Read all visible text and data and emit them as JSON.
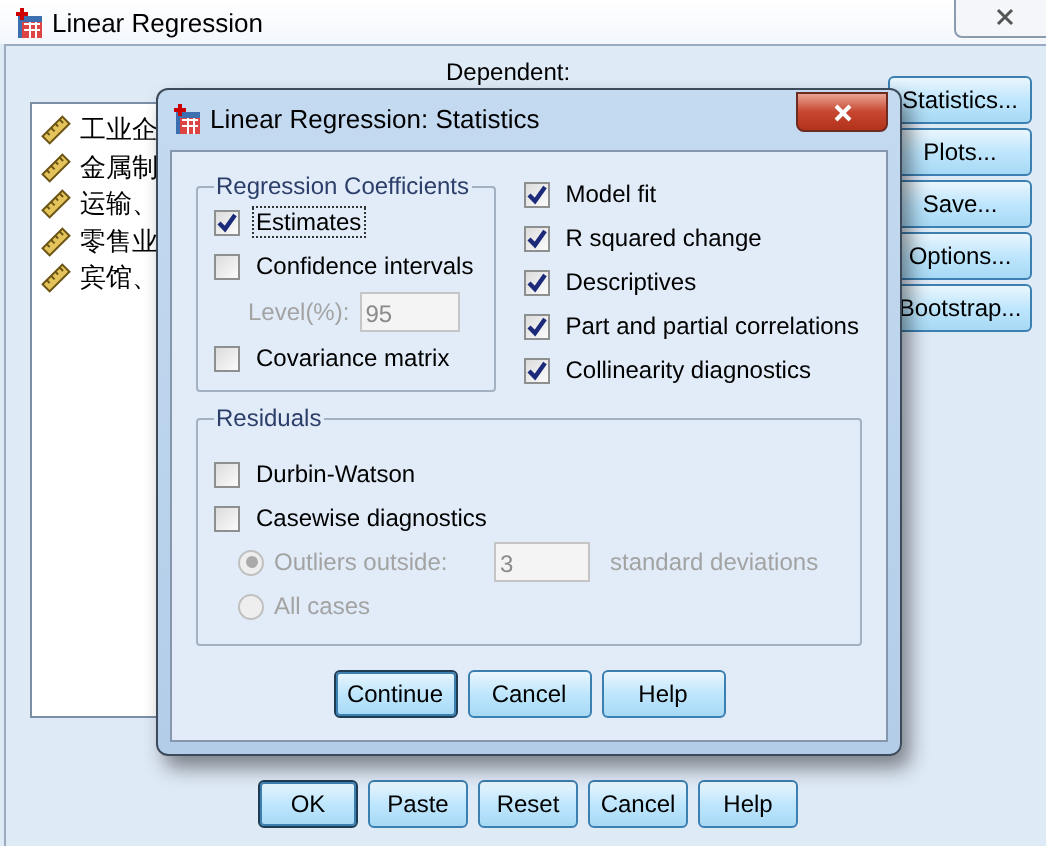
{
  "window": {
    "title": "Linear Regression"
  },
  "variables": [
    {
      "label": "工业企"
    },
    {
      "label": "金属制"
    },
    {
      "label": "运输、"
    },
    {
      "label": "零售业"
    },
    {
      "label": "宾馆、"
    }
  ],
  "dependent_label": "Dependent:",
  "side_buttons": [
    "Statistics...",
    "Plots...",
    "Save...",
    "Options...",
    "Bootstrap..."
  ],
  "buttons": [
    {
      "label": "OK",
      "default": true
    },
    {
      "label": "Paste",
      "default": false
    },
    {
      "label": "Reset",
      "default": false
    },
    {
      "label": "Cancel",
      "default": false
    },
    {
      "label": "Help",
      "default": false
    }
  ],
  "dialog": {
    "title": "Linear Regression: Statistics",
    "coefficients": {
      "title": "Regression Coefficients",
      "items": [
        {
          "label": "Estimates",
          "checked": true,
          "focused": true
        },
        {
          "label": "Confidence intervals",
          "checked": false,
          "focused": false
        }
      ],
      "level": {
        "label": "Level(%):",
        "value": "95",
        "disabled": true
      },
      "after": [
        {
          "label": "Covariance matrix",
          "checked": false,
          "focused": false
        }
      ]
    },
    "options": [
      {
        "label": "Model fit",
        "checked": true
      },
      {
        "label": "R squared change",
        "checked": true
      },
      {
        "label": "Descriptives",
        "checked": true
      },
      {
        "label": "Part and partial correlations",
        "checked": true
      },
      {
        "label": "Collinearity diagnostics",
        "checked": true
      }
    ],
    "residuals": {
      "title": "Residuals",
      "items": [
        {
          "label": "Durbin-Watson",
          "checked": false
        },
        {
          "label": "Casewise diagnostics",
          "checked": false
        }
      ],
      "radios": [
        {
          "label": "Outliers outside:",
          "selected": true,
          "disabled": true
        },
        {
          "label": "All cases",
          "selected": false,
          "disabled": true
        }
      ],
      "outliers": {
        "value": "3",
        "unit": "standard deviations",
        "disabled": true
      }
    },
    "buttons": [
      {
        "label": "Continue",
        "default": true
      },
      {
        "label": "Cancel",
        "default": false
      },
      {
        "label": "Help",
        "default": false
      }
    ]
  }
}
